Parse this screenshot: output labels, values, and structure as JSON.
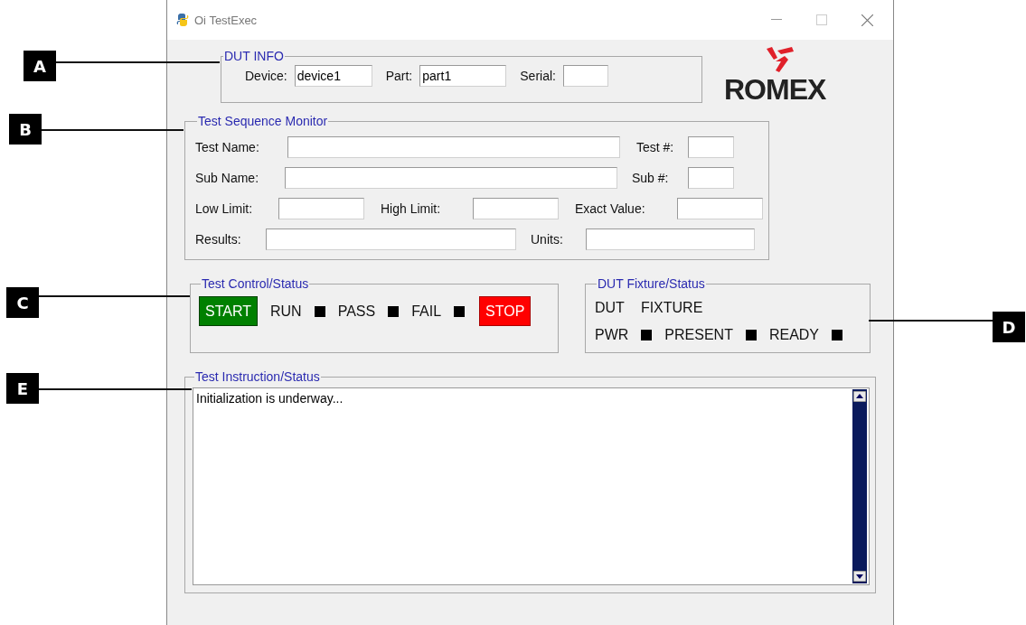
{
  "callouts": [
    {
      "label": "A"
    },
    {
      "label": "B"
    },
    {
      "label": "C"
    },
    {
      "label": "D"
    },
    {
      "label": "E"
    }
  ],
  "window": {
    "title": "Oi TestExec"
  },
  "dut_info": {
    "title": "DUT INFO",
    "fields": [
      {
        "label": "Device:",
        "value": "device1"
      },
      {
        "label": "Part:",
        "value": "part1"
      },
      {
        "label": "Serial:"
      }
    ]
  },
  "logo": {
    "text": "ROMEX"
  },
  "sequence_monitor": {
    "title": "Test Sequence Monitor",
    "rows": [
      [
        {
          "label": "Test Name:"
        },
        {
          "label": "Test #:"
        }
      ],
      [
        {
          "label": "Sub Name:"
        },
        {
          "label": "Sub #:"
        }
      ],
      [
        {
          "label": "Low Limit:"
        },
        {
          "label": "High Limit:"
        },
        {
          "label": "Exact Value:"
        }
      ],
      [
        {
          "label": "Results:"
        },
        {
          "label": "Units:"
        }
      ]
    ]
  },
  "test_control": {
    "title": "Test Control/Status",
    "start": "START",
    "stop": "STOP",
    "indicators": [
      {
        "label": "RUN",
        "on": false
      },
      {
        "label": "PASS",
        "on": false
      },
      {
        "label": "FAIL",
        "on": false
      }
    ]
  },
  "fixture": {
    "title": "DUT Fixture/Status",
    "headers": [
      "DUT",
      "FIXTURE"
    ],
    "indicators": [
      {
        "label": "PWR",
        "on": false
      },
      {
        "label": "PRESENT",
        "on": false
      },
      {
        "label": "READY",
        "on": false
      }
    ]
  },
  "instruction": {
    "title": "Test Instruction/Status",
    "text": "Initialization is underway..."
  }
}
